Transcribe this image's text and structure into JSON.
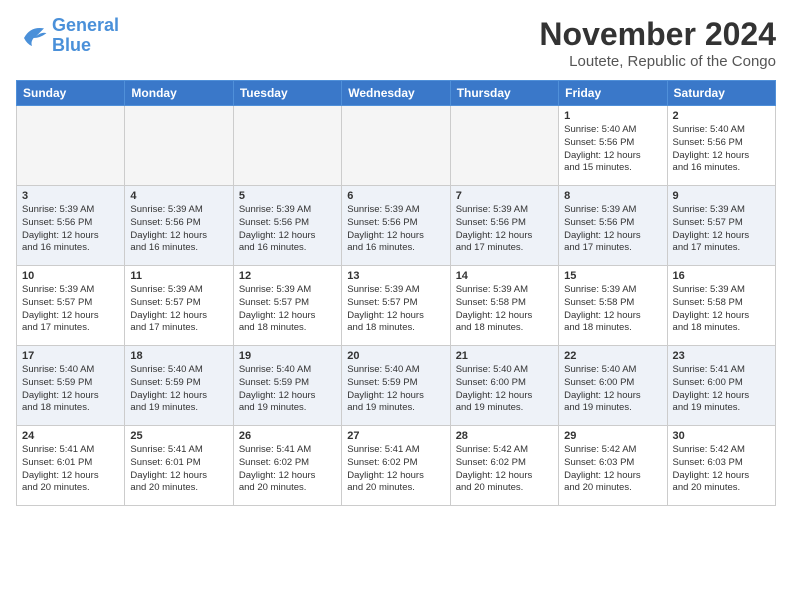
{
  "logo": {
    "line1": "General",
    "line2": "Blue"
  },
  "title": "November 2024",
  "location": "Loutete, Republic of the Congo",
  "weekdays": [
    "Sunday",
    "Monday",
    "Tuesday",
    "Wednesday",
    "Thursday",
    "Friday",
    "Saturday"
  ],
  "weeks": [
    [
      {
        "day": "",
        "info": ""
      },
      {
        "day": "",
        "info": ""
      },
      {
        "day": "",
        "info": ""
      },
      {
        "day": "",
        "info": ""
      },
      {
        "day": "",
        "info": ""
      },
      {
        "day": "1",
        "info": "Sunrise: 5:40 AM\nSunset: 5:56 PM\nDaylight: 12 hours\nand 15 minutes."
      },
      {
        "day": "2",
        "info": "Sunrise: 5:40 AM\nSunset: 5:56 PM\nDaylight: 12 hours\nand 16 minutes."
      }
    ],
    [
      {
        "day": "3",
        "info": "Sunrise: 5:39 AM\nSunset: 5:56 PM\nDaylight: 12 hours\nand 16 minutes."
      },
      {
        "day": "4",
        "info": "Sunrise: 5:39 AM\nSunset: 5:56 PM\nDaylight: 12 hours\nand 16 minutes."
      },
      {
        "day": "5",
        "info": "Sunrise: 5:39 AM\nSunset: 5:56 PM\nDaylight: 12 hours\nand 16 minutes."
      },
      {
        "day": "6",
        "info": "Sunrise: 5:39 AM\nSunset: 5:56 PM\nDaylight: 12 hours\nand 16 minutes."
      },
      {
        "day": "7",
        "info": "Sunrise: 5:39 AM\nSunset: 5:56 PM\nDaylight: 12 hours\nand 17 minutes."
      },
      {
        "day": "8",
        "info": "Sunrise: 5:39 AM\nSunset: 5:56 PM\nDaylight: 12 hours\nand 17 minutes."
      },
      {
        "day": "9",
        "info": "Sunrise: 5:39 AM\nSunset: 5:57 PM\nDaylight: 12 hours\nand 17 minutes."
      }
    ],
    [
      {
        "day": "10",
        "info": "Sunrise: 5:39 AM\nSunset: 5:57 PM\nDaylight: 12 hours\nand 17 minutes."
      },
      {
        "day": "11",
        "info": "Sunrise: 5:39 AM\nSunset: 5:57 PM\nDaylight: 12 hours\nand 17 minutes."
      },
      {
        "day": "12",
        "info": "Sunrise: 5:39 AM\nSunset: 5:57 PM\nDaylight: 12 hours\nand 18 minutes."
      },
      {
        "day": "13",
        "info": "Sunrise: 5:39 AM\nSunset: 5:57 PM\nDaylight: 12 hours\nand 18 minutes."
      },
      {
        "day": "14",
        "info": "Sunrise: 5:39 AM\nSunset: 5:58 PM\nDaylight: 12 hours\nand 18 minutes."
      },
      {
        "day": "15",
        "info": "Sunrise: 5:39 AM\nSunset: 5:58 PM\nDaylight: 12 hours\nand 18 minutes."
      },
      {
        "day": "16",
        "info": "Sunrise: 5:39 AM\nSunset: 5:58 PM\nDaylight: 12 hours\nand 18 minutes."
      }
    ],
    [
      {
        "day": "17",
        "info": "Sunrise: 5:40 AM\nSunset: 5:59 PM\nDaylight: 12 hours\nand 18 minutes."
      },
      {
        "day": "18",
        "info": "Sunrise: 5:40 AM\nSunset: 5:59 PM\nDaylight: 12 hours\nand 19 minutes."
      },
      {
        "day": "19",
        "info": "Sunrise: 5:40 AM\nSunset: 5:59 PM\nDaylight: 12 hours\nand 19 minutes."
      },
      {
        "day": "20",
        "info": "Sunrise: 5:40 AM\nSunset: 5:59 PM\nDaylight: 12 hours\nand 19 minutes."
      },
      {
        "day": "21",
        "info": "Sunrise: 5:40 AM\nSunset: 6:00 PM\nDaylight: 12 hours\nand 19 minutes."
      },
      {
        "day": "22",
        "info": "Sunrise: 5:40 AM\nSunset: 6:00 PM\nDaylight: 12 hours\nand 19 minutes."
      },
      {
        "day": "23",
        "info": "Sunrise: 5:41 AM\nSunset: 6:00 PM\nDaylight: 12 hours\nand 19 minutes."
      }
    ],
    [
      {
        "day": "24",
        "info": "Sunrise: 5:41 AM\nSunset: 6:01 PM\nDaylight: 12 hours\nand 20 minutes."
      },
      {
        "day": "25",
        "info": "Sunrise: 5:41 AM\nSunset: 6:01 PM\nDaylight: 12 hours\nand 20 minutes."
      },
      {
        "day": "26",
        "info": "Sunrise: 5:41 AM\nSunset: 6:02 PM\nDaylight: 12 hours\nand 20 minutes."
      },
      {
        "day": "27",
        "info": "Sunrise: 5:41 AM\nSunset: 6:02 PM\nDaylight: 12 hours\nand 20 minutes."
      },
      {
        "day": "28",
        "info": "Sunrise: 5:42 AM\nSunset: 6:02 PM\nDaylight: 12 hours\nand 20 minutes."
      },
      {
        "day": "29",
        "info": "Sunrise: 5:42 AM\nSunset: 6:03 PM\nDaylight: 12 hours\nand 20 minutes."
      },
      {
        "day": "30",
        "info": "Sunrise: 5:42 AM\nSunset: 6:03 PM\nDaylight: 12 hours\nand 20 minutes."
      }
    ]
  ]
}
